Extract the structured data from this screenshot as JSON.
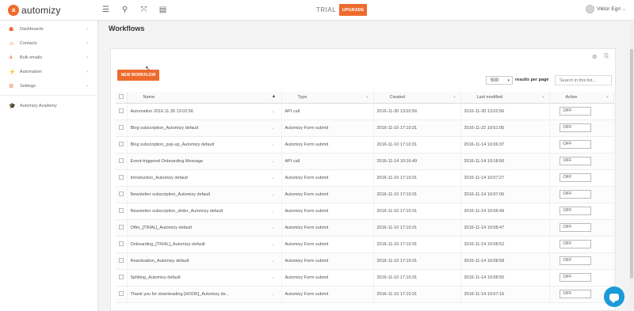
{
  "app": {
    "logo_mark": "a",
    "logo_text": "automizy",
    "trial_label": "TRIAL",
    "upgrade_label": "UPGRADE",
    "user_name": "Viktor Egri",
    "user_caret": "⌄"
  },
  "topbar_icons": [
    {
      "name": "hamburger-icon",
      "glyph": "☰"
    },
    {
      "name": "search-icon",
      "glyph": "⚲"
    },
    {
      "name": "fullscreen-icon",
      "glyph": "⤧"
    },
    {
      "name": "list-icon",
      "glyph": "▤"
    }
  ],
  "sidebar": {
    "items": [
      {
        "label": "Dashboards",
        "icon": "☗",
        "icon_name": "dashboard-icon",
        "has_chevron": true
      },
      {
        "label": "Contacts",
        "icon": "☺",
        "icon_name": "contacts-icon",
        "has_chevron": true
      },
      {
        "label": "Bulk emails",
        "icon": "✈",
        "icon_name": "send-icon",
        "has_chevron": true
      },
      {
        "label": "Automation",
        "icon": "⚡",
        "icon_name": "automation-icon",
        "has_chevron": true
      },
      {
        "label": "Settings",
        "icon": "⚙",
        "icon_name": "gear-icon",
        "has_chevron": true
      }
    ],
    "academy": {
      "label": "Automizy Academy",
      "icon": "🎓",
      "icon_name": "academy-icon"
    },
    "chevron": "›"
  },
  "page": {
    "title": "Workflows"
  },
  "toolbar": {
    "new_workflow_label": "NEW WORKFLOW",
    "per_page_value": "500",
    "per_page_caret": "▾",
    "per_page_label": "results per page",
    "search_placeholder": "Search in this list...",
    "settings_icon": "⚙",
    "export_icon": "⎘"
  },
  "table": {
    "columns": [
      "Name",
      "Type",
      "Created",
      "Last modified",
      "Active"
    ],
    "sort_asc": "▲",
    "sort_none": "▾",
    "row_caret": "⌄",
    "rows": [
      {
        "name": "Automation 2016.11.30 13:02:56",
        "type": "API call",
        "created": "2016-11-30 13:02:56",
        "modified": "2016-11-30 13:02:56",
        "active": "OFF"
      },
      {
        "name": "Blog subscription_Automizy default",
        "type": "Automizy Form submit",
        "created": "2016-11-10 17:10:31",
        "modified": "2016-11-22 10:51:05",
        "active": "OFF"
      },
      {
        "name": "Blog subscription_pop-up_Automizy default",
        "type": "Automizy Form submit",
        "created": "2016-11-10 17:10:31",
        "modified": "2016-11-14 10:06:37",
        "active": "OFF"
      },
      {
        "name": "Event-triggered Onboarding Message",
        "type": "API call",
        "created": "2016-11-14 10:16:49",
        "modified": "2016-11-14 10:18:50",
        "active": "OFF"
      },
      {
        "name": "Introduction_Automizy default",
        "type": "Automizy Form submit",
        "created": "2016-11-10 17:10:31",
        "modified": "2016-11-14 10:07:27",
        "active": "OFF"
      },
      {
        "name": "Newsletter subscription_Automizy default",
        "type": "Automizy Form submit",
        "created": "2016-11-10 17:10:31",
        "modified": "2016-11-14 10:07:06",
        "active": "OFF"
      },
      {
        "name": "Newsletter subscription_slider_Automizy default",
        "type": "Automizy Form submit",
        "created": "2016-11-10 17:10:31",
        "modified": "2016-11-14 10:06:49",
        "active": "OFF"
      },
      {
        "name": "Offer_[TRIAL]_Automizy default",
        "type": "Automizy Form submit",
        "created": "2016-11-10 17:10:31",
        "modified": "2016-11-14 10:08:47",
        "active": "OFF"
      },
      {
        "name": "Onboarding_[TRIAL]_Automizy default",
        "type": "Automizy Form submit",
        "created": "2016-11-10 17:10:31",
        "modified": "2016-11-14 10:08:52",
        "active": "OFF"
      },
      {
        "name": "Reactivation_Automizy default",
        "type": "Automizy Form submit",
        "created": "2016-11-10 17:10:31",
        "modified": "2016-11-14 10:08:58",
        "active": "OFF"
      },
      {
        "name": "Splitting_Automizy default",
        "type": "Automizy Form submit",
        "created": "2016-11-10 17:10:31",
        "modified": "2016-11-14 10:08:55",
        "active": "OFF"
      },
      {
        "name": "Thank you for downloading [HOOK]_Automizy de...",
        "type": "Automizy Form submit",
        "created": "2016-11-10 17:10:31",
        "modified": "2016-11-14 10:07:16",
        "active": "OFF"
      }
    ]
  },
  "colors": {
    "accent": "#ee6b2d",
    "chat": "#1a9ad9"
  }
}
